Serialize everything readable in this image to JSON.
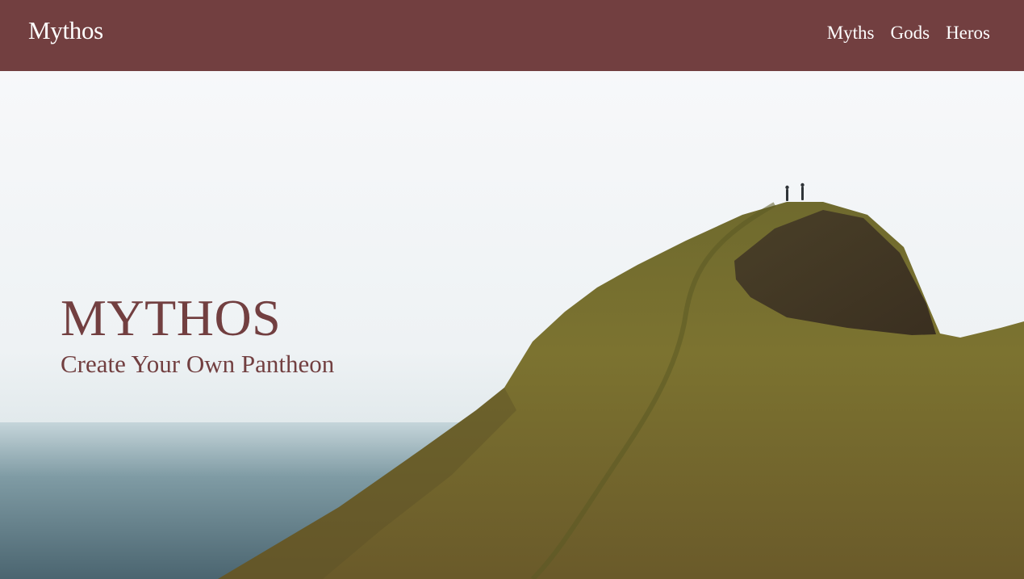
{
  "navbar": {
    "brand": "Mythos",
    "links": [
      {
        "label": "Myths"
      },
      {
        "label": "Gods"
      },
      {
        "label": "Heros"
      }
    ]
  },
  "hero": {
    "title": "MYTHOS",
    "subtitle": "Create Your Own Pantheon",
    "image_icon": "coastal-hill-photo"
  },
  "colors": {
    "brand": "#723f40",
    "nav_text": "#ffffff",
    "hero_text": "#723f40"
  }
}
